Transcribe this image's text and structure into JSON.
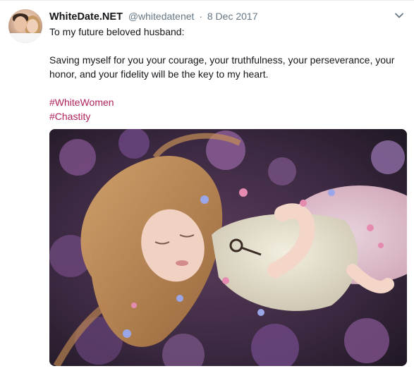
{
  "tweet": {
    "display_name": "WhiteDate.NET",
    "handle": "@whitedatenet",
    "separator": "·",
    "date": "8 Dec 2017",
    "text_line1": "To my future beloved husband:",
    "text_line2": "Saving myself for you your courage, your truthfulness, your perseverance, your honor, and your fidelity will be the key to my heart.",
    "hashtags": [
      "#WhiteWomen",
      "#Chastity"
    ]
  },
  "icons": {
    "caret": "chevron-down-icon",
    "avatar": "avatar"
  },
  "colors": {
    "name": "#14171a",
    "secondary": "#657786",
    "hashtag": "#b0225d",
    "border": "#e6ecf0"
  }
}
